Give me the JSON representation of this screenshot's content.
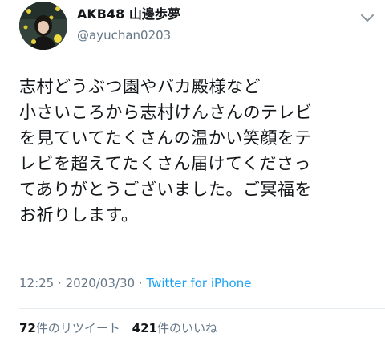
{
  "user": {
    "display_name": "AKB48 山邊歩夢",
    "handle": "@ayuchan0203"
  },
  "tweet": {
    "lines": [
      "志村どうぶつ園やバカ殿様など",
      "小さいころから志村けんさんのテレビ",
      "を見ていてたくさんの温かい笑顔をテ",
      "レビを超えてたくさん届けてくださっ",
      "てありがとうございました。ご冥福を",
      "お祈りします。"
    ],
    "time": "12:25",
    "date": "2020/03/30",
    "separator": "·",
    "source": "Twitter for iPhone"
  },
  "stats": {
    "retweet_count": "72",
    "retweet_label": "件のリツイート",
    "like_count": "421",
    "like_label": "件のいいね"
  },
  "colors": {
    "text": "#14171a",
    "secondary": "#657786",
    "link": "#1da1f2",
    "divider": "#e6ecf0"
  },
  "icons": {
    "menu": "chevron-down-icon"
  }
}
